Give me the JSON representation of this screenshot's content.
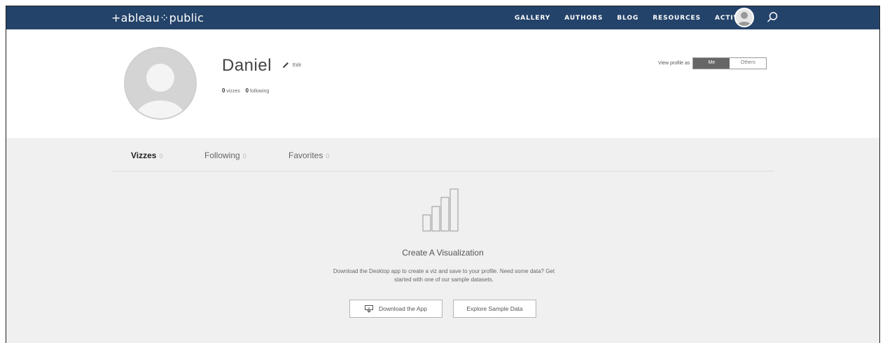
{
  "nav": {
    "logo": "+ableau⁘public",
    "links": [
      "GALLERY",
      "AUTHORS",
      "BLOG",
      "RESOURCES",
      "ACTIVITY"
    ],
    "avatar_icon": "user-avatar-icon",
    "search_icon": "search-icon",
    "bg_color": "#24436a"
  },
  "profile": {
    "name": "Daniel",
    "edit_label": "Edit",
    "vizzes_count": "0",
    "vizzes_label": "vizzes",
    "following_count": "0",
    "following_label": "following",
    "view_as_label": "View profile as",
    "view_as_options": [
      "Me",
      "Others"
    ],
    "view_as_selected": "Me"
  },
  "tabs": [
    {
      "label": "Vizzes",
      "count": "0",
      "active": true
    },
    {
      "label": "Following",
      "count": "0",
      "active": false
    },
    {
      "label": "Favorites",
      "count": "0",
      "active": false
    }
  ],
  "empty_state": {
    "icon": "bar-chart-icon",
    "title": "Create A Visualization",
    "description_line1": "Download the Desktop app to create a viz and save to your profile. Need some data? Get",
    "description_line2": "started with one of our sample datasets.",
    "download_button": "Download the App",
    "explore_button": "Explore Sample Data"
  }
}
